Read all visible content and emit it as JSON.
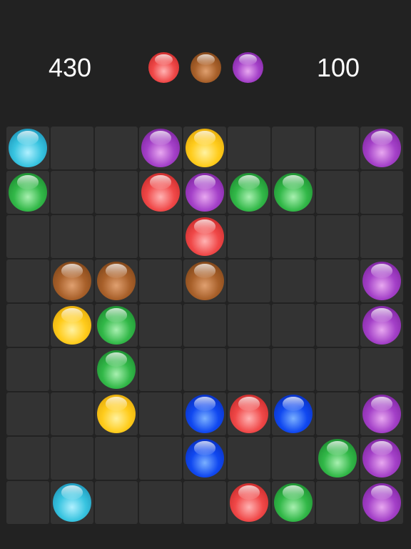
{
  "header": {
    "score_left": "430",
    "score_right": "100",
    "next_balls": [
      "red",
      "brown",
      "purple"
    ]
  },
  "board": {
    "rows": 9,
    "cols": 9,
    "balls": [
      {
        "row": 0,
        "col": 0,
        "color": "cyan"
      },
      {
        "row": 0,
        "col": 3,
        "color": "purple"
      },
      {
        "row": 0,
        "col": 4,
        "color": "yellow"
      },
      {
        "row": 0,
        "col": 8,
        "color": "purple"
      },
      {
        "row": 1,
        "col": 0,
        "color": "green"
      },
      {
        "row": 1,
        "col": 3,
        "color": "red"
      },
      {
        "row": 1,
        "col": 4,
        "color": "purple"
      },
      {
        "row": 1,
        "col": 5,
        "color": "green"
      },
      {
        "row": 1,
        "col": 6,
        "color": "green"
      },
      {
        "row": 2,
        "col": 4,
        "color": "red"
      },
      {
        "row": 3,
        "col": 1,
        "color": "brown"
      },
      {
        "row": 3,
        "col": 2,
        "color": "brown"
      },
      {
        "row": 3,
        "col": 4,
        "color": "brown"
      },
      {
        "row": 3,
        "col": 8,
        "color": "purple"
      },
      {
        "row": 4,
        "col": 1,
        "color": "yellow"
      },
      {
        "row": 4,
        "col": 2,
        "color": "green"
      },
      {
        "row": 4,
        "col": 8,
        "color": "purple"
      },
      {
        "row": 5,
        "col": 2,
        "color": "green"
      },
      {
        "row": 6,
        "col": 2,
        "color": "yellow"
      },
      {
        "row": 6,
        "col": 4,
        "color": "blue"
      },
      {
        "row": 6,
        "col": 5,
        "color": "red"
      },
      {
        "row": 6,
        "col": 6,
        "color": "blue"
      },
      {
        "row": 6,
        "col": 8,
        "color": "purple"
      },
      {
        "row": 7,
        "col": 4,
        "color": "blue"
      },
      {
        "row": 7,
        "col": 7,
        "color": "green"
      },
      {
        "row": 7,
        "col": 8,
        "color": "purple"
      },
      {
        "row": 8,
        "col": 1,
        "color": "cyan"
      },
      {
        "row": 8,
        "col": 5,
        "color": "red"
      },
      {
        "row": 8,
        "col": 6,
        "color": "green"
      },
      {
        "row": 8,
        "col": 8,
        "color": "purple"
      }
    ]
  },
  "colors": {
    "background": "#222222",
    "cell": "#333333",
    "red": [
      "#ffb3b3",
      "#f04848",
      "#b81e1e"
    ],
    "brown": [
      "#e0a070",
      "#a8602a",
      "#6e3a12"
    ],
    "purple": [
      "#e8a8f0",
      "#a440c8",
      "#6e1a90"
    ],
    "cyan": [
      "#b0f0ff",
      "#38c4e0",
      "#1080a8"
    ],
    "yellow": [
      "#fff2a0",
      "#ffcc1c",
      "#d89a00"
    ],
    "green": [
      "#a8f0b0",
      "#32b848",
      "#137a26"
    ],
    "blue": [
      "#7ab0ff",
      "#1048f0",
      "#0424a8"
    ]
  }
}
